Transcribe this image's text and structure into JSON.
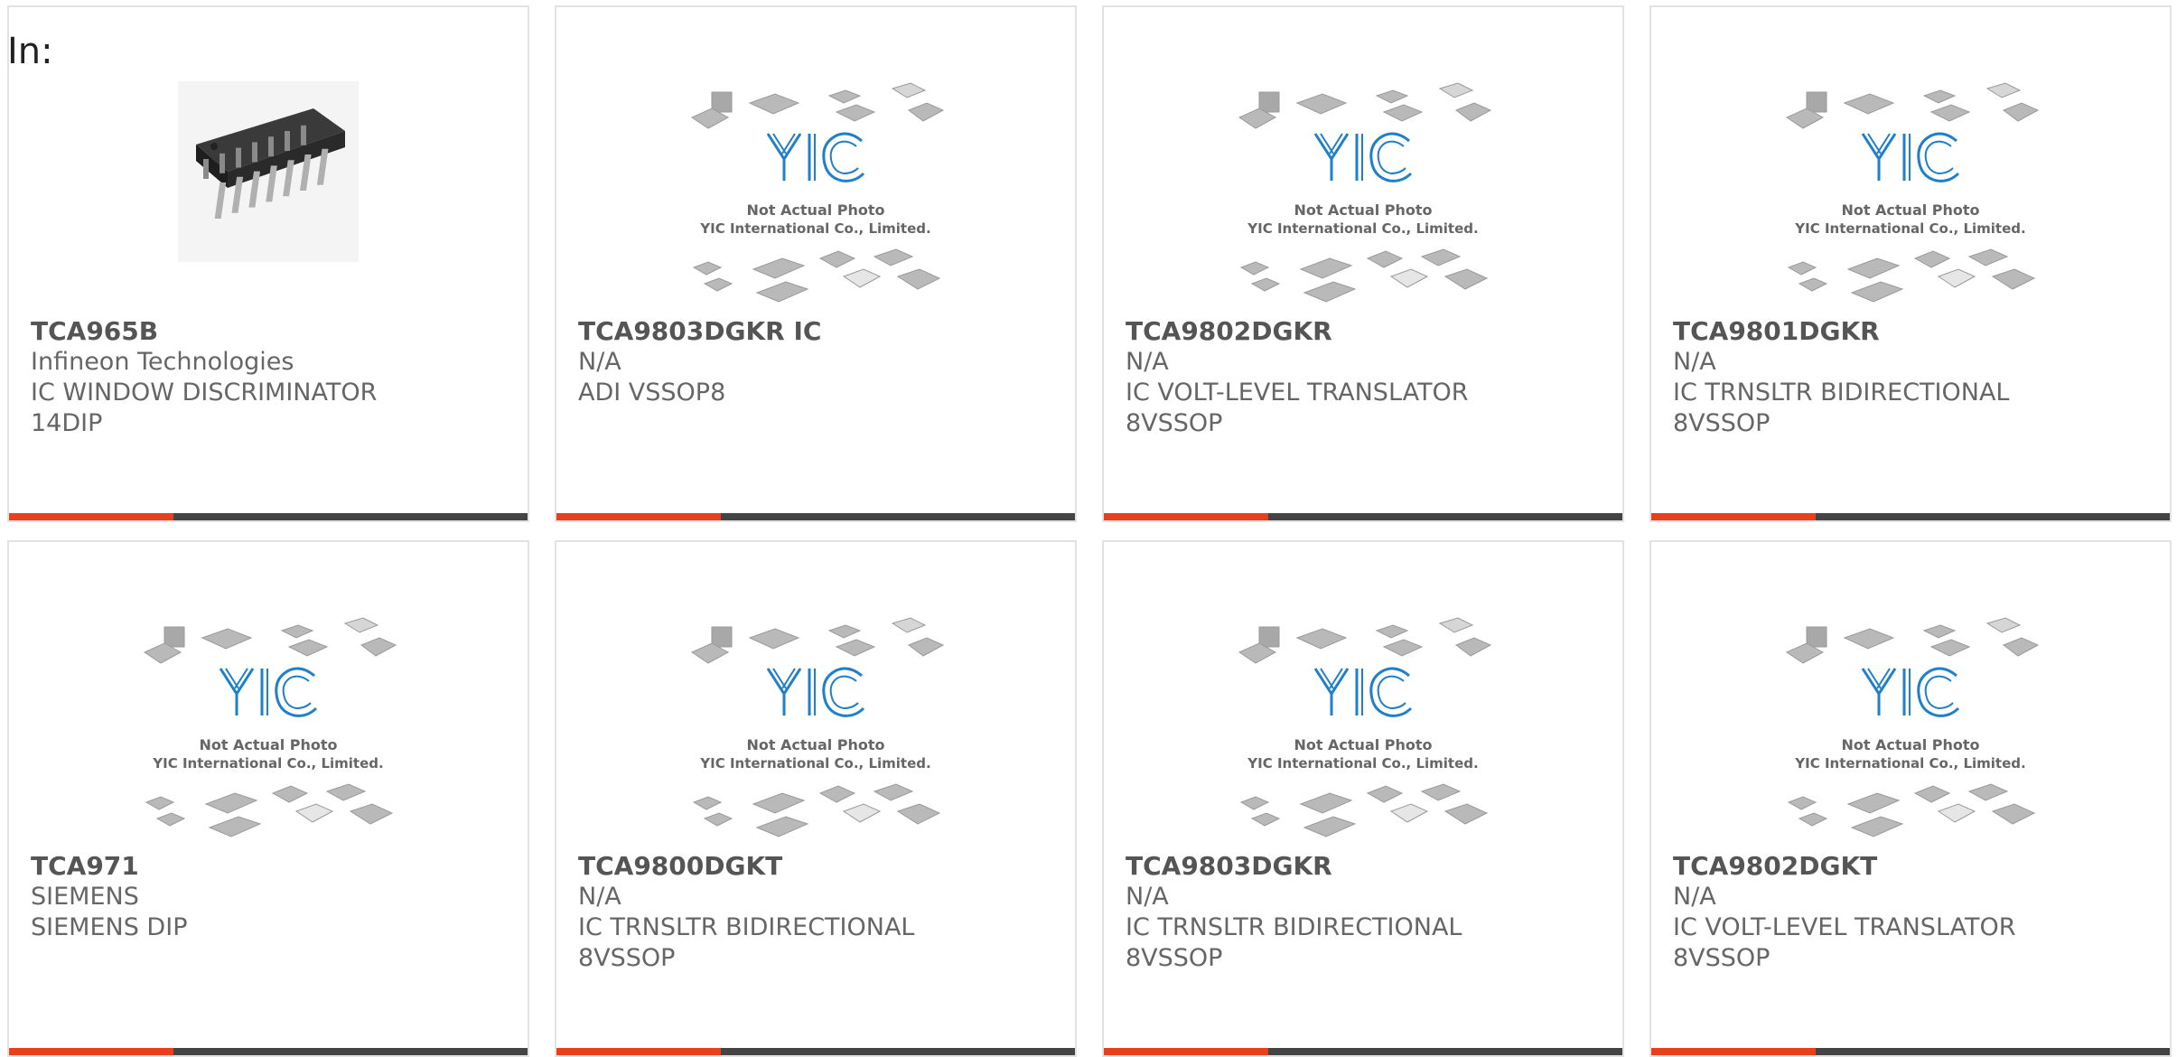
{
  "heading": "In:",
  "placeholder_caption": {
    "logo": "YIC",
    "line1": "Not Actual Photo",
    "line2": "YIC International Co., Limited."
  },
  "colors": {
    "accent": "#e8401c",
    "bar": "#444444",
    "logo": "#1f7fc9"
  },
  "products": [
    {
      "part": "TCA965B",
      "lines": [
        "Infineon Technologies",
        "IC WINDOW DISCRIMINATOR",
        "14DIP"
      ],
      "image": "chip-photo"
    },
    {
      "part": "TCA9803DGKR IC",
      "lines": [
        "N/A",
        "ADI VSSOP8"
      ],
      "image": "placeholder"
    },
    {
      "part": "TCA9802DGKR",
      "lines": [
        "N/A",
        "IC VOLT-LEVEL TRANSLATOR",
        "8VSSOP"
      ],
      "image": "placeholder"
    },
    {
      "part": "TCA9801DGKR",
      "lines": [
        "N/A",
        "IC TRNSLTR BIDIRECTIONAL",
        "8VSSOP"
      ],
      "image": "placeholder"
    },
    {
      "part": "TCA971",
      "lines": [
        "SIEMENS",
        "SIEMENS DIP"
      ],
      "image": "placeholder"
    },
    {
      "part": "TCA9800DGKT",
      "lines": [
        "N/A",
        "IC TRNSLTR BIDIRECTIONAL",
        "8VSSOP"
      ],
      "image": "placeholder"
    },
    {
      "part": "TCA9803DGKR",
      "lines": [
        "N/A",
        "IC TRNSLTR BIDIRECTIONAL",
        "8VSSOP"
      ],
      "image": "placeholder"
    },
    {
      "part": "TCA9802DGKT",
      "lines": [
        "N/A",
        "IC VOLT-LEVEL TRANSLATOR",
        "8VSSOP"
      ],
      "image": "placeholder"
    }
  ]
}
